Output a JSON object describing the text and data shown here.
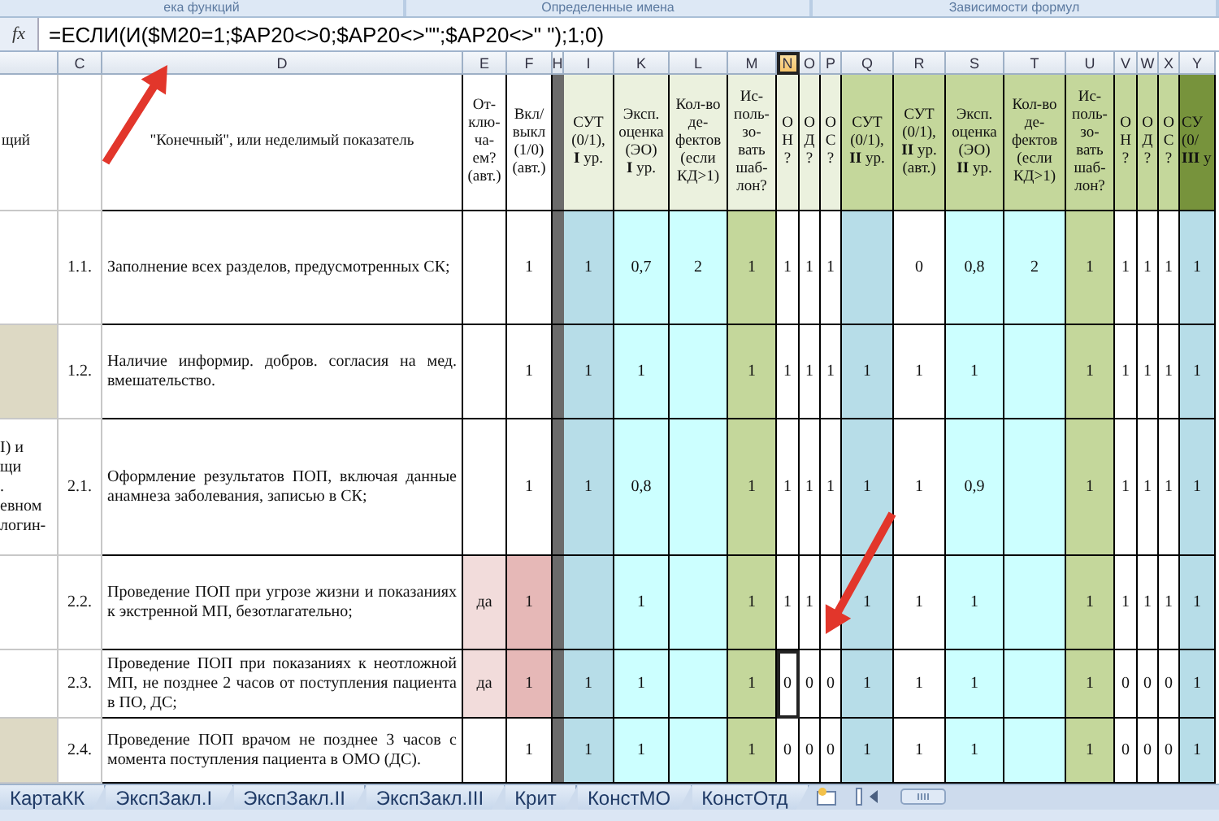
{
  "ribbon_groups": [
    "ека функций",
    "Определенные имена",
    "Зависимости формул"
  ],
  "formula_bar": {
    "button_label": "fx",
    "formula": "=ЕСЛИ(И($M20=1;$AP20<>0;$AP20<>\"\";$AP20<>\" \");1;0)"
  },
  "columns": [
    {
      "kind": "label",
      "header": "щий"
    },
    {
      "letter": "C",
      "selected": false,
      "kind": "number"
    },
    {
      "letter": "D",
      "selected": false,
      "kind": "indicator",
      "header": "\"Конечный\", или неделимый показатель"
    },
    {
      "letter": "E",
      "selected": false,
      "kind": "flag",
      "header": "От-\nклю-\nча-\nем?\n(авт.)"
    },
    {
      "letter": "F",
      "selected": false,
      "kind": "switch",
      "header": "Вкл/\nвыкл\n(1/0)\n(авт.)"
    },
    {
      "letter": "H",
      "selected": false,
      "kind": "separator"
    },
    {
      "letter": "I",
      "selected": false,
      "kind": "sut1",
      "header": "СУТ\n(0/1),\n**I** ур."
    },
    {
      "letter": "K",
      "selected": false,
      "kind": "score1",
      "header": "Эксп.\nоценка\n(ЭО)\n**I** ур."
    },
    {
      "letter": "L",
      "selected": false,
      "kind": "defects1",
      "header": "Кол-во\nде-\nфектов\n(если\nКД>1)"
    },
    {
      "letter": "M",
      "selected": false,
      "kind": "template1",
      "header": "Ис-\nполь-\nзо-\nвать\nшаб-\nлон?"
    },
    {
      "letter": "N",
      "selected": true,
      "kind": "check1",
      "header": "О\nН\n?"
    },
    {
      "letter": "O",
      "selected": false,
      "kind": "check1",
      "header": "О\nД\n?"
    },
    {
      "letter": "P",
      "selected": false,
      "kind": "check1",
      "header": "О\nС\n?"
    },
    {
      "letter": "Q",
      "selected": false,
      "kind": "sut2",
      "header": "СУТ\n(0/1),\n**II** ур."
    },
    {
      "letter": "R",
      "selected": false,
      "kind": "sut2auto",
      "header": "СУТ\n(0/1),\n**II** ур.\n(авт.)"
    },
    {
      "letter": "S",
      "selected": false,
      "kind": "score2",
      "header": "Эксп.\nоценка\n(ЭО)\n**II** ур."
    },
    {
      "letter": "T",
      "selected": false,
      "kind": "defects2",
      "header": "Кол-во\nде-\nфектов\n(если\nКД>1)"
    },
    {
      "letter": "U",
      "selected": false,
      "kind": "template2",
      "header": "Ис-\nполь-\nзо-\nвать\nшаб-\nлон?"
    },
    {
      "letter": "V",
      "selected": false,
      "kind": "check2",
      "header": "О\nН\n?"
    },
    {
      "letter": "W",
      "selected": false,
      "kind": "check2",
      "header": "О\nД\n?"
    },
    {
      "letter": "X",
      "selected": false,
      "kind": "check2",
      "header": "О\nС\n?"
    },
    {
      "letter": "Y",
      "selected": false,
      "kind": "sut3",
      "header": "СУ\n(0/\n**III** у"
    }
  ],
  "rows": [
    {
      "cells": [
        {
          "selected": false
        },
        {
          "value": "1.1.",
          "selected": false
        },
        {
          "value": "Заполнение всех разделов, предусмотренных СК;",
          "selected": false
        },
        {
          "selected": false
        },
        {
          "value": "1",
          "selected": false
        },
        {
          "selected": false
        },
        {
          "value": "1",
          "selected": false
        },
        {
          "value": "0,7",
          "selected": false
        },
        {
          "value": "2",
          "selected": false
        },
        {
          "value": "1",
          "selected": false
        },
        {
          "value": "1",
          "selected": false
        },
        {
          "value": "1",
          "selected": false
        },
        {
          "value": "1",
          "selected": false
        },
        {
          "selected": false
        },
        {
          "value": "0",
          "selected": false
        },
        {
          "value": "0,8",
          "selected": false
        },
        {
          "value": "2",
          "selected": false
        },
        {
          "value": "1",
          "selected": false
        },
        {
          "value": "1",
          "selected": false
        },
        {
          "value": "1",
          "selected": false
        },
        {
          "value": "1",
          "selected": false
        },
        {
          "value": "1",
          "selected": false
        }
      ]
    },
    {
      "cells": [
        {
          "selected": false,
          "color": "#ddd9c4"
        },
        {
          "value": "1.2.",
          "selected": false
        },
        {
          "value": "Наличие информир. добров. согласия на мед. вмешательство.",
          "selected": false
        },
        {
          "selected": false
        },
        {
          "value": "1",
          "selected": false
        },
        {
          "selected": false
        },
        {
          "value": "1",
          "selected": false
        },
        {
          "value": "1",
          "selected": false
        },
        {
          "selected": false
        },
        {
          "value": "1",
          "selected": false
        },
        {
          "value": "1",
          "selected": false
        },
        {
          "value": "1",
          "selected": false
        },
        {
          "value": "1",
          "selected": false
        },
        {
          "value": "1",
          "selected": false
        },
        {
          "value": "1",
          "selected": false
        },
        {
          "value": "1",
          "selected": false
        },
        {
          "selected": false
        },
        {
          "value": "1",
          "selected": false
        },
        {
          "value": "1",
          "selected": false
        },
        {
          "value": "1",
          "selected": false
        },
        {
          "value": "1",
          "selected": false
        },
        {
          "value": "1",
          "selected": false
        }
      ]
    },
    {
      "cells": [
        {
          "value": "I) и\nщи\n.\nевном\nлогин-",
          "selected": false
        },
        {
          "value": "2.1.",
          "selected": false
        },
        {
          "value": "Оформление результатов ПОП, включая данные анамнеза заболевания, записью в СК;",
          "selected": false
        },
        {
          "selected": false
        },
        {
          "value": "1",
          "selected": false
        },
        {
          "selected": false
        },
        {
          "value": "1",
          "selected": false
        },
        {
          "value": "0,8",
          "selected": false
        },
        {
          "selected": false
        },
        {
          "value": "1",
          "selected": false
        },
        {
          "value": "1",
          "selected": false
        },
        {
          "value": "1",
          "selected": false
        },
        {
          "value": "1",
          "selected": false
        },
        {
          "value": "1",
          "selected": false
        },
        {
          "value": "1",
          "selected": false
        },
        {
          "value": "0,9",
          "selected": false
        },
        {
          "selected": false
        },
        {
          "value": "1",
          "selected": false
        },
        {
          "value": "1",
          "selected": false
        },
        {
          "value": "1",
          "selected": false
        },
        {
          "value": "1",
          "selected": false
        },
        {
          "value": "1",
          "selected": false
        }
      ]
    },
    {
      "cells": [
        {
          "selected": false
        },
        {
          "value": "2.2.",
          "selected": false
        },
        {
          "value": "Проведение ПОП при угрозе жизни и показаниях к экстренной МП, безотлагательно;",
          "selected": false
        },
        {
          "value": "да",
          "selected": false,
          "color": "#f2dcdb"
        },
        {
          "value": "1",
          "selected": false,
          "color": "#e6b8b7"
        },
        {
          "selected": false
        },
        {
          "selected": false
        },
        {
          "value": "1",
          "selected": false
        },
        {
          "selected": false
        },
        {
          "value": "1",
          "selected": false
        },
        {
          "value": "1",
          "selected": false
        },
        {
          "value": "1",
          "selected": false
        },
        {
          "selected": false
        },
        {
          "value": "1",
          "selected": false
        },
        {
          "value": "1",
          "selected": false
        },
        {
          "value": "1",
          "selected": false
        },
        {
          "selected": false
        },
        {
          "value": "1",
          "selected": false
        },
        {
          "value": "1",
          "selected": false
        },
        {
          "value": "1",
          "selected": false
        },
        {
          "value": "1",
          "selected": false
        },
        {
          "value": "1",
          "selected": false
        }
      ]
    },
    {
      "cells": [
        {
          "selected": false
        },
        {
          "value": "2.3.",
          "selected": false
        },
        {
          "value": "Проведение ПОП при показаниях к неотложной МП, не позднее 2 часов от поступления пациента в ПО, ДС;",
          "selected": false
        },
        {
          "value": "да",
          "selected": false,
          "color": "#f2dcdb"
        },
        {
          "value": "1",
          "selected": false,
          "color": "#e6b8b7"
        },
        {
          "selected": false
        },
        {
          "value": "1",
          "selected": false
        },
        {
          "value": "1",
          "selected": false
        },
        {
          "selected": false
        },
        {
          "value": "1",
          "selected": false
        },
        {
          "value": "0",
          "selected": true
        },
        {
          "value": "0",
          "selected": false
        },
        {
          "value": "0",
          "selected": false
        },
        {
          "value": "1",
          "selected": false
        },
        {
          "value": "1",
          "selected": false
        },
        {
          "value": "1",
          "selected": false
        },
        {
          "selected": false
        },
        {
          "value": "1",
          "selected": false
        },
        {
          "value": "0",
          "selected": false
        },
        {
          "value": "0",
          "selected": false
        },
        {
          "value": "0",
          "selected": false
        },
        {
          "value": "1",
          "selected": false
        }
      ]
    },
    {
      "cells": [
        {
          "selected": false,
          "color": "#ddd9c4"
        },
        {
          "value": "2.4.",
          "selected": false
        },
        {
          "value": "Проведение ПОП врачом не позднее 3 часов с момента поступления пациента в ОМО (ДС).",
          "selected": false
        },
        {
          "selected": false
        },
        {
          "value": "1",
          "selected": false
        },
        {
          "selected": false
        },
        {
          "value": "1",
          "selected": false
        },
        {
          "value": "1",
          "selected": false
        },
        {
          "selected": false
        },
        {
          "value": "1",
          "selected": false
        },
        {
          "value": "0",
          "selected": false
        },
        {
          "value": "0",
          "selected": false
        },
        {
          "value": "0",
          "selected": false
        },
        {
          "value": "1",
          "selected": false
        },
        {
          "value": "1",
          "selected": false
        },
        {
          "value": "1",
          "selected": false
        },
        {
          "selected": false
        },
        {
          "value": "1",
          "selected": false
        },
        {
          "value": "0",
          "selected": false
        },
        {
          "value": "0",
          "selected": false
        },
        {
          "value": "0",
          "selected": false
        },
        {
          "value": "1",
          "selected": false
        }
      ]
    }
  ],
  "sheet_tabs": [
    {
      "label": "КартаКК",
      "selected": false
    },
    {
      "label": "ЭкспЗакл.I",
      "selected": false
    },
    {
      "label": "ЭкспЗакл.II",
      "selected": false
    },
    {
      "label": "ЭкспЗакл.III",
      "selected": false
    },
    {
      "label": "Крит",
      "selected": false
    },
    {
      "label": "КонстМО",
      "selected": false
    },
    {
      "label": "КонстОтд",
      "selected": false
    }
  ],
  "annotation_arrows": [
    {
      "kind": "arrow"
    },
    {
      "kind": "arrow"
    }
  ]
}
